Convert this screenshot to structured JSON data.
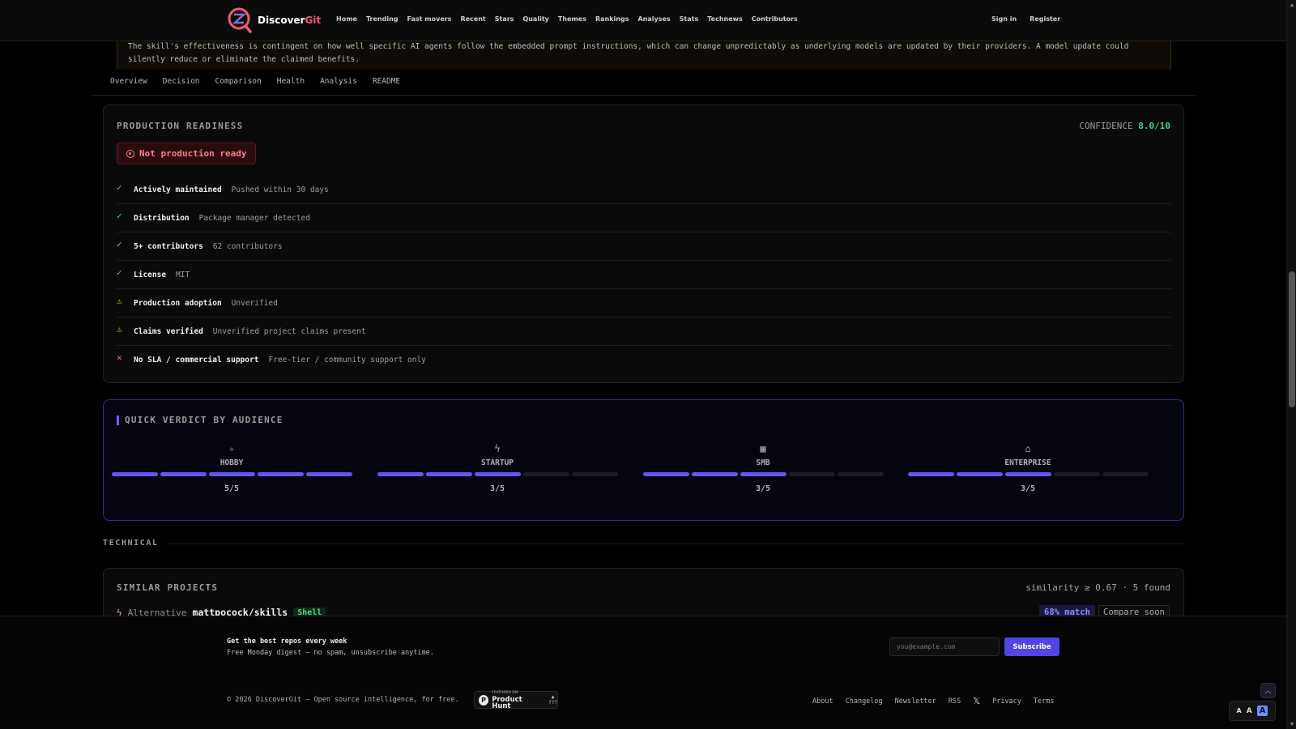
{
  "brand": {
    "name_part1": "Discover",
    "name_part2": "Git"
  },
  "nav": [
    "Home",
    "Trending",
    "Fast movers",
    "Recent",
    "Stars",
    "Quality",
    "Themes",
    "Rankings",
    "Analyses",
    "Stats",
    "Technews",
    "Contributors"
  ],
  "auth": {
    "signin": "Sign in",
    "register": "Register"
  },
  "banner": {
    "text": "The skill's effectiveness is contingent on how well specific AI agents follow the embedded prompt instructions, which can change unpredictably as underlying models are updated by their providers. A model update could silently reduce or eliminate the claimed benefits."
  },
  "tabs": [
    "Overview",
    "Decision",
    "Comparison",
    "Health",
    "Analysis",
    "README"
  ],
  "production": {
    "title": "PRODUCTION READINESS",
    "confidence_label": "CONFIDENCE",
    "confidence_score": "8.0/10",
    "status": "Not production ready",
    "checks": [
      {
        "status": "ok",
        "icon": "✓",
        "label": "Actively maintained",
        "desc": "Pushed within 30 days"
      },
      {
        "status": "ok",
        "icon": "✓",
        "label": "Distribution",
        "desc": "Package manager detected"
      },
      {
        "status": "ok",
        "icon": "✓",
        "label": "5+ contributors",
        "desc": "62 contributors"
      },
      {
        "status": "ok",
        "icon": "✓",
        "label": "License",
        "desc": "MIT"
      },
      {
        "status": "warn",
        "icon": "⚠",
        "label": "Production adoption",
        "desc": "Unverified"
      },
      {
        "status": "warn",
        "icon": "⚠",
        "label": "Claims verified",
        "desc": "Unverified project claims present"
      },
      {
        "status": "bad",
        "icon": "✕",
        "label": "No SLA / commercial support",
        "desc": "Free-tier / community support only"
      }
    ]
  },
  "verdict": {
    "title": "QUICK VERDICT BY AUDIENCE",
    "audiences": [
      {
        "name": "HOBBY",
        "icon": "✧",
        "score_text": "5/5",
        "score": 5,
        "max": 5
      },
      {
        "name": "STARTUP",
        "icon": "ϟ",
        "score_text": "3/5",
        "score": 3,
        "max": 5
      },
      {
        "name": "SMB",
        "icon": "▦",
        "score_text": "3/5",
        "score": 3,
        "max": 5
      },
      {
        "name": "ENTERPRISE",
        "icon": "⌂",
        "score_text": "3/5",
        "score": 3,
        "max": 5
      }
    ]
  },
  "technical": {
    "label": "TECHNICAL"
  },
  "similar": {
    "title": "SIMILAR PROJECTS",
    "meta": "similarity ≥ 0.67 · 5 found",
    "row": {
      "kind": "Alternative",
      "repo": "mattpocock/skills",
      "lang": "Shell",
      "match": "68% match",
      "compare": "Compare soon"
    }
  },
  "footer": {
    "newsletter_title": "Get the best repos every week",
    "newsletter_sub": "Free Monday digest — no spam, unsubscribe anytime.",
    "email_placeholder": "you@example.com",
    "subscribe": "Subscribe",
    "copyright": "© 2026 DiscoverGit — Open source intelligence, for free.",
    "ph_small": "FEATURED ON",
    "ph_big": "Product Hunt",
    "ph_votes": "???",
    "links": [
      "About",
      "Changelog",
      "Newsletter",
      "RSS"
    ],
    "links2": [
      "Privacy",
      "Terms"
    ],
    "font_sizes": [
      "A",
      "A",
      "A"
    ]
  },
  "colors": {
    "accent": "#4f46e5",
    "ok": "#3fd18e",
    "warn": "#e8b339",
    "bad": "#f36a72",
    "brand_pink": "#ef5a75"
  }
}
